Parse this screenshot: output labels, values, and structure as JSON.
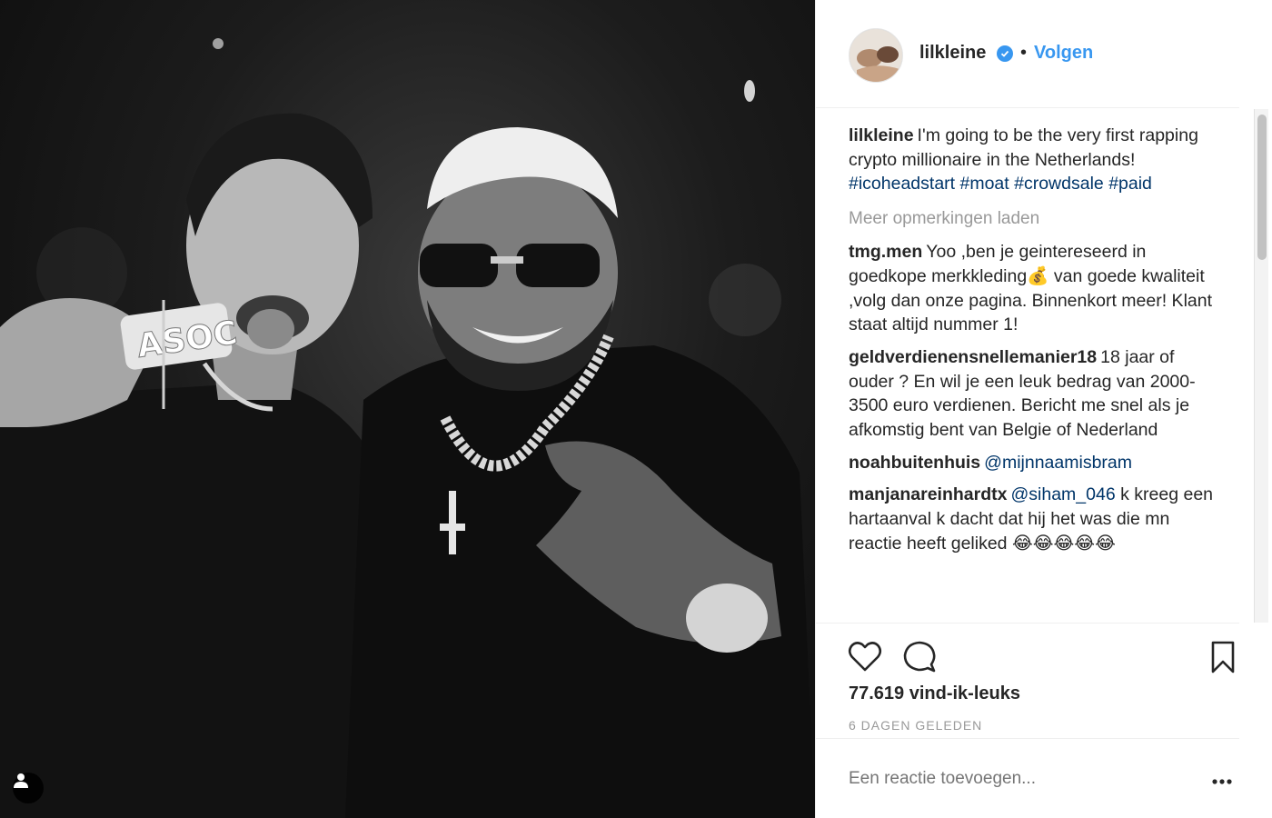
{
  "post": {
    "author": "lilkleine",
    "verified": true,
    "separator": "•",
    "follow_label": "Volgen"
  },
  "caption": {
    "user": "lilkleine",
    "text": "I'm going to be the very first rapping crypto millionaire in the Netherlands!",
    "hashtags": [
      "#icoheadstart",
      "#moat",
      "#crowdsale",
      "#paid"
    ]
  },
  "load_more_label": "Meer opmerkingen laden",
  "comments": [
    {
      "user": "tmg.men",
      "text": "Yoo ,ben je geintereseerd in goedkope merkkleding💰 van goede kwaliteit ,volg dan onze pagina. Binnenkort meer! Klant staat altijd nummer 1!"
    },
    {
      "user": "geldverdienensnellemanier18",
      "text": "18 jaar of ouder ? En wil je een leuk bedrag van 2000-3500 euro verdienen. Bericht me snel als je afkomstig bent van Belgie of Nederland"
    },
    {
      "user": "noahbuitenhuis",
      "mention": "@mijnnaamisbram",
      "text": ""
    },
    {
      "user": "manjanareinhardtx",
      "mention": "@siham_046",
      "text": "k kreeg een hartaanval k dacht dat hij het was die mn reactie heeft geliked 😂😂😂😂😂"
    }
  ],
  "likes_text": "77.619 vind-ik-leuks",
  "timestamp": "6 DAGEN GELEDEN",
  "add_comment_placeholder": "Een reactie toevoegen...",
  "photo": {
    "chain_text": "ASOC"
  },
  "icons": {
    "like": "heart-icon",
    "comment": "speech-bubble-icon",
    "save": "bookmark-icon",
    "more": "ellipsis-icon",
    "tag": "person-tag-icon"
  },
  "colors": {
    "link": "#003569",
    "follow": "#3897f0",
    "muted": "#999999",
    "text": "#262626"
  }
}
